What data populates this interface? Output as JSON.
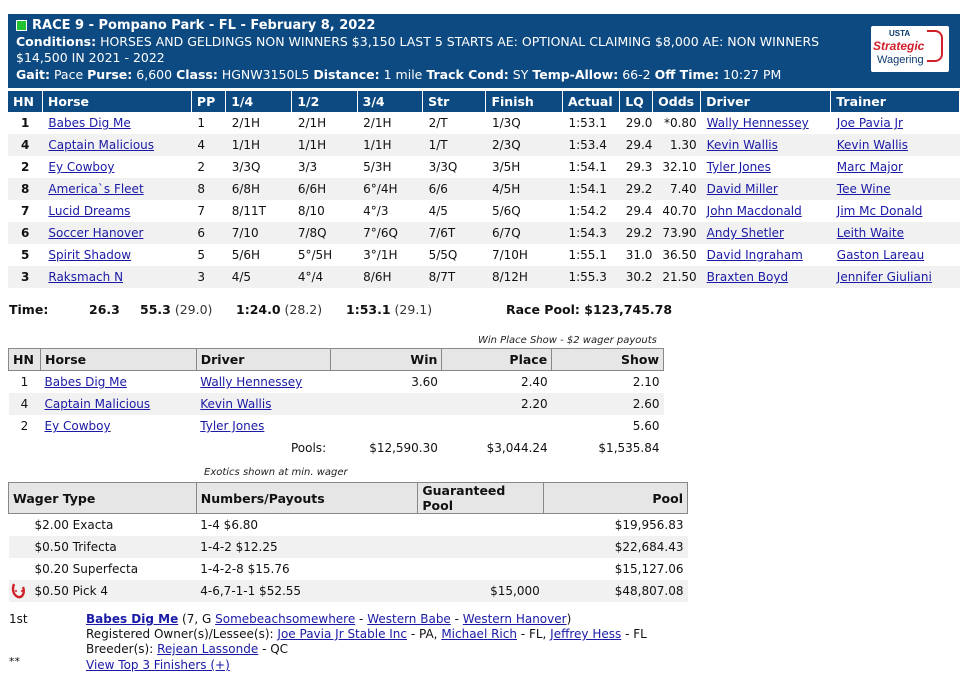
{
  "header": {
    "title": "RACE 9 - Pompano Park - FL - February 8, 2022",
    "conditions_label": "Conditions:",
    "conditions": "HORSES AND GELDINGS NON WINNERS $3,150 LAST 5 STARTS AE: OPTIONAL CLAIMING $8,000 AE: NON WINNERS $14,500 IN 2021 - 2022",
    "gait_label": "Gait:",
    "gait": "Pace",
    "purse_label": "Purse:",
    "purse": "6,600",
    "class_label": "Class:",
    "class": "HGNW3150L5",
    "distance_label": "Distance:",
    "distance": "1 mile",
    "track_label": "Track Cond:",
    "track": "SY",
    "temp_label": "Temp-Allow:",
    "temp": "66-2",
    "off_label": "Off Time:",
    "off": "10:27 PM",
    "logo": {
      "top": "USTA",
      "middle": "Strategic",
      "bottom": "Wagering"
    }
  },
  "results": {
    "columns": [
      "HN",
      "Horse",
      "PP",
      "1/4",
      "1/2",
      "3/4",
      "Str",
      "Finish",
      "Actual",
      "LQ",
      "Odds",
      "Driver",
      "Trainer"
    ],
    "rows": [
      {
        "hn": "1",
        "horse": "Babes Dig Me",
        "pp": "1",
        "q1": "2/1H",
        "q2": "2/1H",
        "q3": "2/1H",
        "str": "2/T",
        "fin": "1/3Q",
        "actual": "1:53.1",
        "lq": "29.0",
        "odds": "*0.80",
        "driver": "Wally Hennessey",
        "trainer": "Joe Pavia Jr"
      },
      {
        "hn": "4",
        "horse": "Captain Malicious",
        "pp": "4",
        "q1": "1/1H",
        "q2": "1/1H",
        "q3": "1/1H",
        "str": "1/T",
        "fin": "2/3Q",
        "actual": "1:53.4",
        "lq": "29.4",
        "odds": "1.30",
        "driver": "Kevin Wallis",
        "trainer": "Kevin Wallis"
      },
      {
        "hn": "2",
        "horse": "Ey Cowboy",
        "pp": "2",
        "q1": "3/3Q",
        "q2": "3/3",
        "q3": "5/3H",
        "str": "3/3Q",
        "fin": "3/5H",
        "actual": "1:54.1",
        "lq": "29.3",
        "odds": "32.10",
        "driver": "Tyler Jones",
        "trainer": "Marc Major"
      },
      {
        "hn": "8",
        "horse": "America`s Fleet",
        "pp": "8",
        "q1": "6/8H",
        "q2": "6/6H",
        "q3": "6°/4H",
        "str": "6/6",
        "fin": "4/5H",
        "actual": "1:54.1",
        "lq": "29.2",
        "odds": "7.40",
        "driver": "David Miller",
        "trainer": "Tee Wine"
      },
      {
        "hn": "7",
        "horse": "Lucid Dreams",
        "pp": "7",
        "q1": "8/11T",
        "q2": "8/10",
        "q3": "4°/3",
        "str": "4/5",
        "fin": "5/6Q",
        "actual": "1:54.2",
        "lq": "29.4",
        "odds": "40.70",
        "driver": "John Macdonald",
        "trainer": "Jim Mc Donald"
      },
      {
        "hn": "6",
        "horse": "Soccer Hanover",
        "pp": "6",
        "q1": "7/10",
        "q2": "7/8Q",
        "q3": "7°/6Q",
        "str": "7/6T",
        "fin": "6/7Q",
        "actual": "1:54.3",
        "lq": "29.2",
        "odds": "73.90",
        "driver": "Andy Shetler",
        "trainer": "Leith Waite"
      },
      {
        "hn": "5",
        "horse": "Spirit Shadow",
        "pp": "5",
        "q1": "5/6H",
        "q2": "5°/5H",
        "q3": "3°/1H",
        "str": "5/5Q",
        "fin": "7/10H",
        "actual": "1:55.1",
        "lq": "31.0",
        "odds": "36.50",
        "driver": "David Ingraham",
        "trainer": "Gaston Lareau"
      },
      {
        "hn": "3",
        "horse": "Raksmach N",
        "pp": "3",
        "q1": "4/5",
        "q2": "4°/4",
        "q3": "8/6H",
        "str": "8/7T",
        "fin": "8/12H",
        "actual": "1:55.3",
        "lq": "30.2",
        "odds": "21.50",
        "driver": "Braxten Boyd",
        "trainer": "Jennifer Giuliani"
      }
    ]
  },
  "time": {
    "label": "Time:",
    "q1": "26.3",
    "q2": "55.3",
    "q2_part": "(29.0)",
    "q3": "1:24.0",
    "q3_part": "(28.2)",
    "fin": "1:53.1",
    "fin_part": "(29.1)",
    "pool": "Race Pool: $123,745.78"
  },
  "wps": {
    "note": "Win Place Show - $2 wager payouts",
    "columns": [
      "HN",
      "Horse",
      "Driver",
      "Win",
      "Place",
      "Show"
    ],
    "rows": [
      {
        "hn": "1",
        "horse": "Babes Dig Me",
        "driver": "Wally Hennessey",
        "win": "3.60",
        "place": "2.40",
        "show": "2.10"
      },
      {
        "hn": "4",
        "horse": "Captain Malicious",
        "driver": "Kevin Wallis",
        "win": "",
        "place": "2.20",
        "show": "2.60"
      },
      {
        "hn": "2",
        "horse": "Ey Cowboy",
        "driver": "Tyler Jones",
        "win": "",
        "place": "",
        "show": "5.60"
      }
    ],
    "pools_label": "Pools:",
    "pools": {
      "win": "$12,590.30",
      "place": "$3,044.24",
      "show": "$1,535.84"
    }
  },
  "exotics": {
    "note": "Exotics shown at min. wager",
    "columns": [
      "Wager Type",
      "Numbers/Payouts",
      "Guaranteed Pool",
      "Pool"
    ],
    "rows": [
      {
        "type": "$2.00 Exacta",
        "payout": "1-4 $6.80",
        "guaranteed": "",
        "pool": "$19,956.83"
      },
      {
        "type": "$0.50 Trifecta",
        "payout": "1-4-2 $12.25",
        "guaranteed": "",
        "pool": "$22,684.43"
      },
      {
        "type": "$0.20 Superfecta",
        "payout": "1-4-2-8 $15.76",
        "guaranteed": "",
        "pool": "$15,127.06"
      },
      {
        "type": "$0.50 Pick 4",
        "payout": "4-6,7-1-1 $52.55",
        "guaranteed": "$15,000",
        "pool": "$48,807.08"
      }
    ]
  },
  "footer": {
    "place": "1st",
    "horse": "Babes Dig Me",
    "desc": "(7, G",
    "sire": "Somebeachsomewhere",
    "dam": "Western Babe",
    "damsire": "Western Hanover",
    "close": ")",
    "owners_label": "Registered Owner(s)/Lessee(s):",
    "owner1": "Joe Pavia Jr Stable Inc",
    "owner1_loc": "- PA,",
    "owner2": "Michael Rich",
    "owner2_loc": "- FL,",
    "owner3": "Jeffrey Hess",
    "owner3_loc": "- FL",
    "breeder_label": "Breeder(s):",
    "breeder": "Rejean Lassonde",
    "breeder_loc": "- QC",
    "stars": "**",
    "top3_link": "View Top 3 Finishers (+)"
  }
}
